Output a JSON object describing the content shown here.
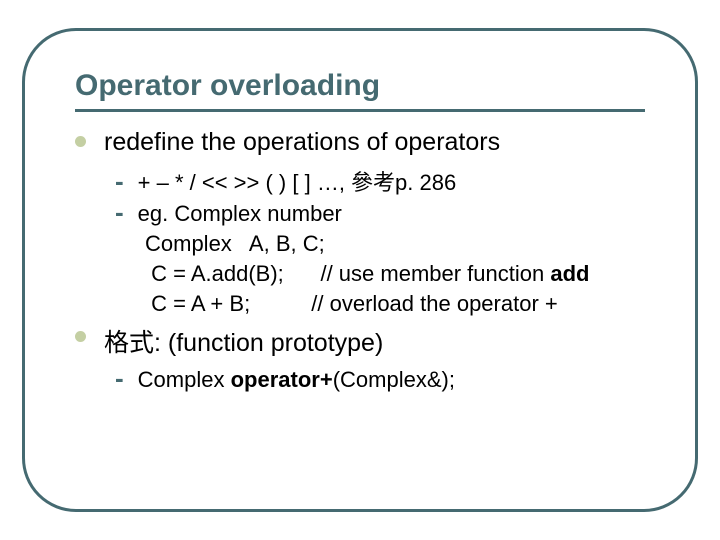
{
  "title": "Operator overloading",
  "bullets": {
    "b1": "redefine the operations of operators",
    "b1_s1": "+   –   *   /   <<   >>  ( )   [ ]  …,  參考p. 286",
    "b1_s2": "eg.  Complex number",
    "code1": "Complex   A, B, C;",
    "code2_a": " C = A.add(B);      // use member function ",
    "code2_b": "add",
    "code3": " C = A + B;          // overload the operator +",
    "b2": "格式: (function prototype)",
    "b2_s1_a": "Complex  ",
    "b2_s1_b": "operator+",
    "b2_s1_c": "(Complex&);"
  }
}
